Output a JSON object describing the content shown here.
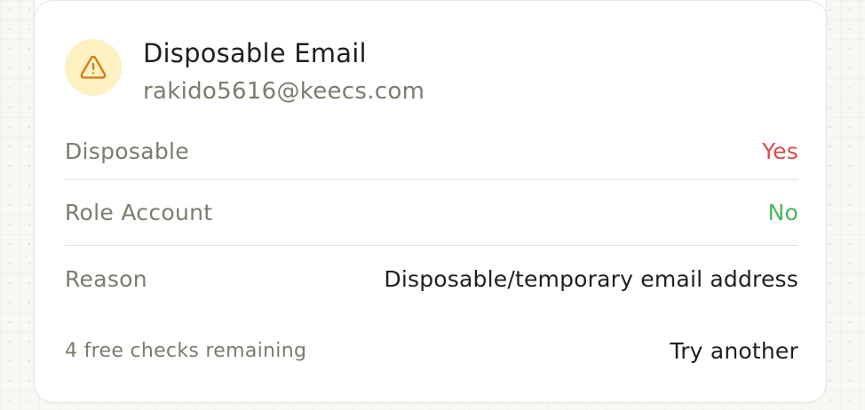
{
  "result": {
    "title": "Disposable Email",
    "email": "rakido5616@keecs.com",
    "icon": "warning-triangle-icon",
    "colors": {
      "icon_bg": "#fdf1c2",
      "icon_stroke": "#d97a1a",
      "yes": "#d94b4b",
      "no": "#4cb85c"
    }
  },
  "details": {
    "disposable": {
      "label": "Disposable",
      "value": "Yes"
    },
    "role_account": {
      "label": "Role Account",
      "value": "No"
    },
    "reason": {
      "label": "Reason",
      "value": "Disposable/temporary email address"
    }
  },
  "footer": {
    "checks_remaining": "4 free checks remaining",
    "try_another": "Try another"
  }
}
